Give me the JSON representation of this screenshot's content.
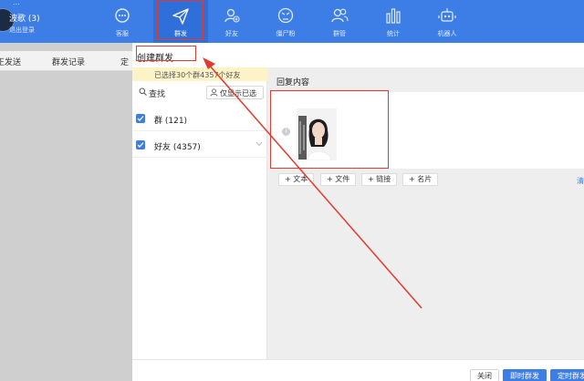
{
  "app": {
    "title_strip": "...",
    "user_name": "波歌 (3)",
    "logout": "退出登录"
  },
  "nav": [
    {
      "label": "客服",
      "icon": "chat-icon"
    },
    {
      "label": "群发",
      "icon": "paper-plane-icon",
      "active": true
    },
    {
      "label": "好友",
      "icon": "add-friend-icon"
    },
    {
      "label": "僵尸粉",
      "icon": "zombie-fan-icon"
    },
    {
      "label": "群管",
      "icon": "group-manage-icon"
    },
    {
      "label": "统计",
      "icon": "bar-stats-icon"
    },
    {
      "label": "机器人",
      "icon": "robot-icon"
    }
  ],
  "left_tabs": [
    "正发送",
    "群发记录",
    "定"
  ],
  "dialog": {
    "title": "创建群发",
    "selected_banner": "已选择30个群4357个好友",
    "search_label": "查找",
    "only_selected": "仅显示已选",
    "groups": [
      {
        "label": "群 (121)",
        "checked": true
      },
      {
        "label": "好友 (4357)",
        "checked": true
      }
    ],
    "reply_label": "回复内容",
    "add_buttons": [
      "+ 文本",
      "+ 文件",
      "+ 链接",
      "+ 名片"
    ],
    "edge_glyph": "清",
    "buttons": {
      "close": "关闭",
      "send_now": "即时群发",
      "schedule": "定时群发"
    }
  },
  "colors": {
    "header_blue": "#3c7de6",
    "highlight_red": "#e3392f",
    "banner_yellow": "#fdf3c7"
  }
}
